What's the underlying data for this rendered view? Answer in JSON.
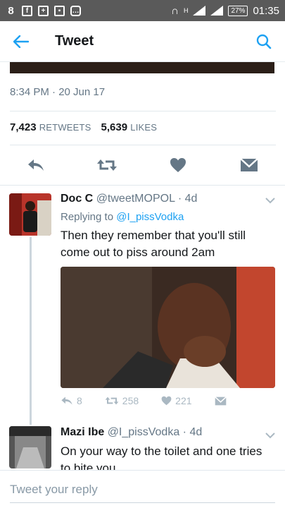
{
  "status_bar": {
    "battery": "27%",
    "time": "01:35",
    "network": "H"
  },
  "header": {
    "title": "Tweet"
  },
  "tweet": {
    "timestamp": "8:34 PM · 20 Jun 17",
    "retweets_count": "7,423",
    "retweets_label": "RETWEETS",
    "likes_count": "5,639",
    "likes_label": "LIKES"
  },
  "replies": [
    {
      "name": "Doc C",
      "handle": "@tweetMOPOL",
      "age": "· 4d",
      "replying_prefix": "Replying to",
      "replying_handle": "@I_pissVodka",
      "text": "Then they remember that you'll still come out to piss around 2am",
      "reply_count": "8",
      "retweet_count": "258",
      "like_count": "221"
    },
    {
      "name": "Mazi Ibe",
      "handle": "@I_pissVodka",
      "age": "· 4d",
      "text": "On your way to the toilet and one tries to bite you"
    }
  ],
  "composer": {
    "placeholder": "Tweet your reply"
  }
}
